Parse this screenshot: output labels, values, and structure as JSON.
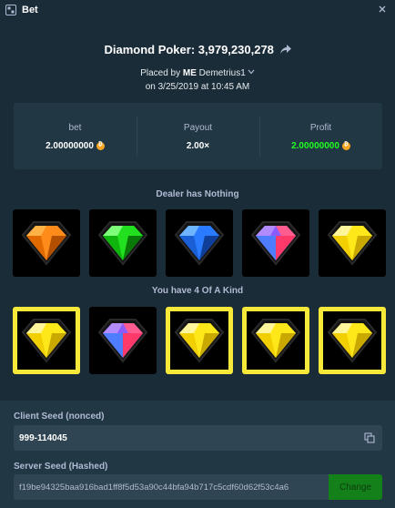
{
  "window": {
    "title": "Bet",
    "icon": "game-icon"
  },
  "header": {
    "game_title": "Diamond Poker: 3,979,230,278",
    "placed_by_prefix": "Placed by",
    "me_badge": "ME",
    "username": "Demetrius1",
    "date": "on 3/25/2019 at 10:45 AM"
  },
  "stats": {
    "bet_label": "bet",
    "bet_value": "2.00000000",
    "payout_label": "Payout",
    "payout_value": "2.00×",
    "profit_label": "Profit",
    "profit_value": "2.00000000",
    "currency_icon": "bitcoin-icon"
  },
  "dealer": {
    "caption": "Dealer has Nothing",
    "gems": [
      "orange",
      "green",
      "blue",
      "multicolor",
      "yellow"
    ]
  },
  "player": {
    "caption": "You have 4 Of A Kind",
    "gems": [
      "yellow",
      "multicolor",
      "yellow",
      "yellow",
      "yellow"
    ],
    "highlighted": [
      true,
      false,
      true,
      true,
      true
    ]
  },
  "seeds": {
    "client_label": "Client Seed (nonced)",
    "client_value": "999-114045",
    "server_label": "Server Seed (Hashed)",
    "server_value": "f19be94325baa916bad1ff8f5d53a90c44bfa94b717c5cdf60d62f53c4a6",
    "change_label": "Change"
  },
  "colors": {
    "background": "#1a2c38",
    "panel": "#213743",
    "profit_green": "#1fff20",
    "highlight_yellow": "#f7e93a",
    "change_button": "#14801a"
  }
}
